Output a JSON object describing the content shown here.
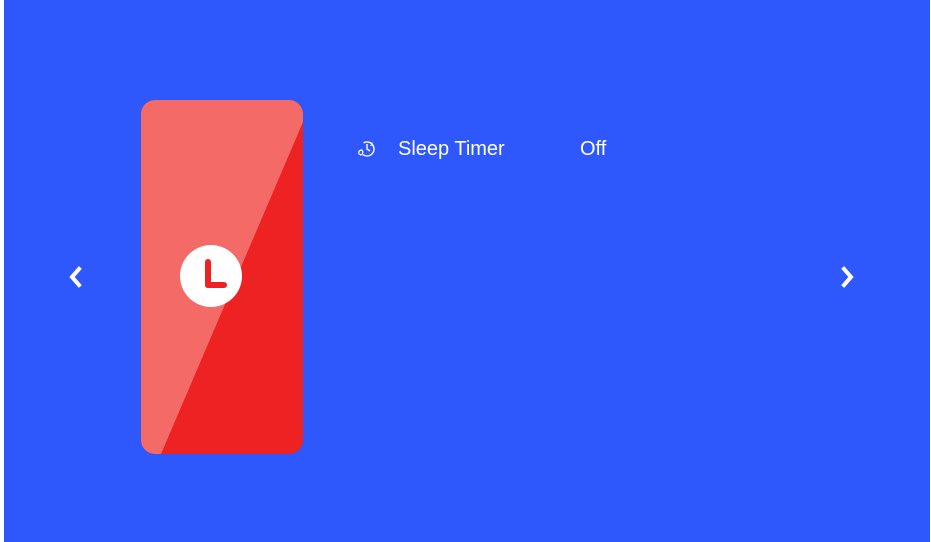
{
  "colors": {
    "background": "#2e58fc",
    "card_light": "#f46a66",
    "card_dark": "#ee2222",
    "text": "#ffffff"
  },
  "navigation": {
    "prev_icon": "chevron-left-icon",
    "next_icon": "chevron-right-icon"
  },
  "card": {
    "icon": "clock-icon"
  },
  "setting": {
    "icon": "sleep-timer-icon",
    "label": "Sleep Timer",
    "value": "Off"
  }
}
